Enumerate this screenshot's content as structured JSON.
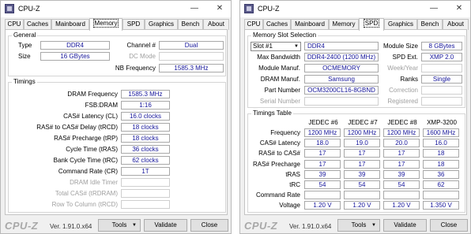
{
  "left": {
    "title": "CPU-Z",
    "tabs": [
      "CPU",
      "Caches",
      "Mainboard",
      "Memory",
      "SPD",
      "Graphics",
      "Bench",
      "About"
    ],
    "active_tab": "Memory",
    "general": {
      "legend": "General",
      "type_label": "Type",
      "type_value": "DDR4",
      "size_label": "Size",
      "size_value": "16 GBytes",
      "channel_label": "Channel #",
      "channel_value": "Dual",
      "dcmode_label": "DC Mode",
      "dcmode_value": "",
      "nbfreq_label": "NB Frequency",
      "nbfreq_value": "1585.3 MHz"
    },
    "timings": {
      "legend": "Timings",
      "rows": [
        {
          "label": "DRAM Frequency",
          "value": "1585.3 MHz",
          "disabled": false
        },
        {
          "label": "FSB:DRAM",
          "value": "1:16",
          "disabled": false
        },
        {
          "label": "CAS# Latency (CL)",
          "value": "16.0 clocks",
          "disabled": false
        },
        {
          "label": "RAS# to CAS# Delay (tRCD)",
          "value": "18 clocks",
          "disabled": false
        },
        {
          "label": "RAS# Precharge (tRP)",
          "value": "18 clocks",
          "disabled": false
        },
        {
          "label": "Cycle Time (tRAS)",
          "value": "36 clocks",
          "disabled": false
        },
        {
          "label": "Bank Cycle Time (tRC)",
          "value": "62 clocks",
          "disabled": false
        },
        {
          "label": "Command Rate (CR)",
          "value": "1T",
          "disabled": false
        },
        {
          "label": "DRAM Idle Timer",
          "value": "",
          "disabled": true
        },
        {
          "label": "Total CAS# (tRDRAM)",
          "value": "",
          "disabled": true
        },
        {
          "label": "Row To Column (tRCD)",
          "value": "",
          "disabled": true
        }
      ]
    }
  },
  "right": {
    "title": "CPU-Z",
    "tabs": [
      "CPU",
      "Caches",
      "Mainboard",
      "Memory",
      "SPD",
      "Graphics",
      "Bench",
      "About"
    ],
    "active_tab": "SPD",
    "slot": {
      "legend": "Memory Slot Selection",
      "selected": "Slot #1",
      "type_value": "DDR4",
      "module_size_label": "Module Size",
      "module_size_value": "8 GBytes",
      "max_bw_label": "Max Bandwidth",
      "max_bw_value": "DDR4-2400 (1200 MHz)",
      "spd_ext_label": "SPD Ext.",
      "spd_ext_value": "XMP 2.0",
      "manuf_label": "Module Manuf.",
      "manuf_value": "OCMEMORY",
      "weekyear_label": "Week/Year",
      "weekyear_value": "",
      "dram_manuf_label": "DRAM Manuf.",
      "dram_manuf_value": "Samsung",
      "ranks_label": "Ranks",
      "ranks_value": "Single",
      "part_label": "Part Number",
      "part_value": "OCM3200CL16-8GBND",
      "correction_label": "Correction",
      "correction_value": "",
      "serial_label": "Serial Number",
      "serial_value": "",
      "registered_label": "Registered",
      "registered_value": ""
    },
    "timings_table": {
      "legend": "Timings Table",
      "columns": [
        "JEDEC #6",
        "JEDEC #7",
        "JEDEC #8",
        "XMP-3200"
      ],
      "rows": [
        {
          "label": "Frequency",
          "values": [
            "1200 MHz",
            "1200 MHz",
            "1200 MHz",
            "1600 MHz"
          ]
        },
        {
          "label": "CAS# Latency",
          "values": [
            "18.0",
            "19.0",
            "20.0",
            "16.0"
          ]
        },
        {
          "label": "RAS# to CAS#",
          "values": [
            "17",
            "17",
            "17",
            "18"
          ]
        },
        {
          "label": "RAS# Precharge",
          "values": [
            "17",
            "17",
            "17",
            "18"
          ]
        },
        {
          "label": "tRAS",
          "values": [
            "39",
            "39",
            "39",
            "36"
          ]
        },
        {
          "label": "tRC",
          "values": [
            "54",
            "54",
            "54",
            "62"
          ]
        },
        {
          "label": "Command Rate",
          "values": [
            "",
            "",
            "",
            ""
          ]
        },
        {
          "label": "Voltage",
          "values": [
            "1.20 V",
            "1.20 V",
            "1.20 V",
            "1.350 V"
          ]
        }
      ]
    }
  },
  "footer": {
    "brand": "CPU-Z",
    "version": "Ver. 1.91.0.x64",
    "tools_label": "Tools",
    "validate_label": "Validate",
    "close_label": "Close"
  },
  "titlebar": {
    "minimize": "—",
    "close": "✕"
  },
  "colors": {
    "value_text": "#15159a",
    "disabled_text": "#a0a0a0",
    "window_bg": "#f0f0f0"
  }
}
